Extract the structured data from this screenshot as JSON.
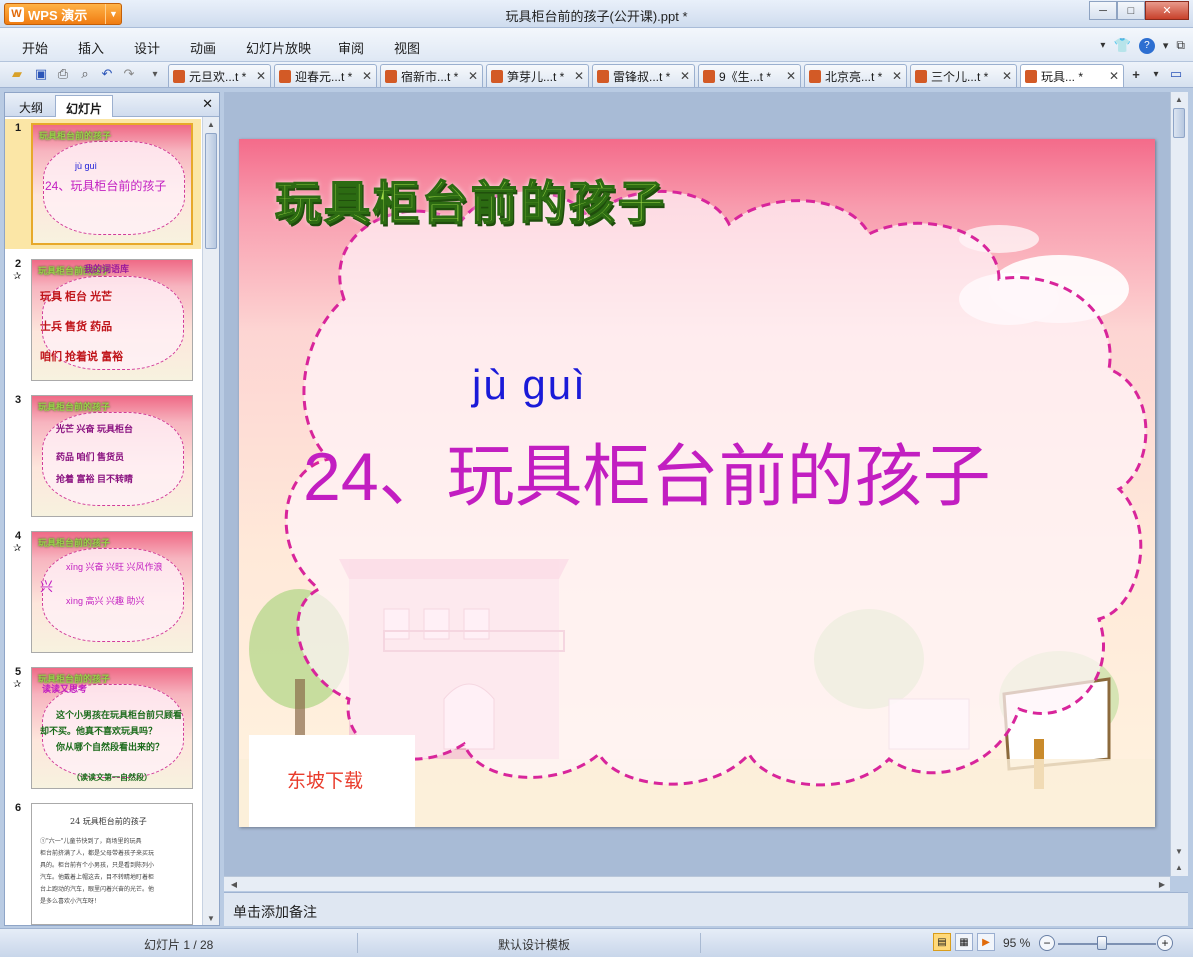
{
  "app": {
    "name": "WPS 演示",
    "logo_glyph": "W",
    "document_title": "玩具柜台前的孩子(公开课).ppt *"
  },
  "window_controls": {
    "minimize": "─",
    "maximize": "□",
    "close": "✕"
  },
  "menu": {
    "items": [
      "开始",
      "插入",
      "设计",
      "动画",
      "幻灯片放映",
      "审阅",
      "视图"
    ],
    "right_icons": [
      "dropdown-icon",
      "skin-icon",
      "help-icon",
      "restore-icon"
    ]
  },
  "toolbar": {
    "icons": [
      "open-icon",
      "save-icon",
      "print-icon",
      "print-preview-icon",
      "undo-icon",
      "redo-icon",
      "customize-icon"
    ],
    "doc_tabs": [
      {
        "label": "元旦欢...t *",
        "close": "✕"
      },
      {
        "label": "迎春元...t *",
        "close": "✕"
      },
      {
        "label": "宿新市...t *",
        "close": "✕"
      },
      {
        "label": "笋芽儿...t *",
        "close": "✕"
      },
      {
        "label": "雷锋叔...t *",
        "close": "✕"
      },
      {
        "label": "9《生...t *",
        "close": "✕"
      },
      {
        "label": "北京亮...t *",
        "close": "✕"
      },
      {
        "label": "三个儿...t *",
        "close": "✕"
      },
      {
        "label": "玩具... *",
        "close": "✕"
      }
    ],
    "new_tab": "+",
    "tab_menu": "▾"
  },
  "left_panel": {
    "tabs": [
      "大纲",
      "幻灯片"
    ],
    "active_tab": "幻灯片",
    "close": "✕",
    "thumbnails": [
      {
        "num": "1",
        "star": "",
        "title": "玩具柜台前的孩子",
        "lines": [
          "jù guì",
          "24、玩具柜台前的孩子"
        ]
      },
      {
        "num": "2",
        "star": "✰",
        "title": "玩具柜台前的孩子",
        "lines": [
          "我的词语库",
          "玩具   柜台   光芒",
          "士兵   售货   药品",
          "咱们   抢着说   富裕"
        ]
      },
      {
        "num": "3",
        "star": "",
        "title": "玩具柜台前的孩子",
        "lines": [
          "光芒   兴奋   玩具柜台",
          "药品   咱们   售货员",
          "抢着   富裕   目不转睛"
        ]
      },
      {
        "num": "4",
        "star": "✰",
        "title": "玩具柜台前的孩子",
        "lines": [
          "xīng  兴奋 兴旺 兴风作浪",
          "兴",
          "xìng  高兴 兴趣 助兴"
        ]
      },
      {
        "num": "5",
        "star": "✰",
        "title": "玩具柜台前的孩子",
        "lines": [
          "读读又思考",
          "这个小男孩在玩具柜台前只顾看",
          "却不买。他真不喜欢玩具吗？",
          "你从哪个自然段看出来的？",
          "（读读文第一自然段）"
        ]
      },
      {
        "num": "6",
        "star": "",
        "title": "24   玩具柜台前的孩子",
        "lines": [
          "①\"六一\"儿童节快到了，商场里的玩具",
          "柜台前挤满了人，都是父母带着孩子来买玩",
          "具的。柜台前有个小男孩，只是看到陈列小",
          "汽车。他戴着上帽这去，目不转睛地盯着柜",
          "台上跑动的汽车，眼里闪着兴奋的光芒。他",
          "是多么喜欢小汽车呀！"
        ]
      }
    ]
  },
  "slide": {
    "title": "玩具柜台前的孩子",
    "pinyin": "jù  guì",
    "heading": "24、玩具柜台前的孩子",
    "label": "东坡下载",
    "colors": {
      "heading": "#c21ec1",
      "pinyin": "#1a1ad8",
      "label": "#e93b2b",
      "title": "#a6e04a"
    }
  },
  "notes": {
    "placeholder": "单击添加备注"
  },
  "status": {
    "slide_counter": "幻灯片 1 / 28",
    "template": "默认设计模板",
    "zoom": "95 %",
    "zoom_percent": 95,
    "zoom_minus": "−",
    "zoom_plus": "+"
  }
}
